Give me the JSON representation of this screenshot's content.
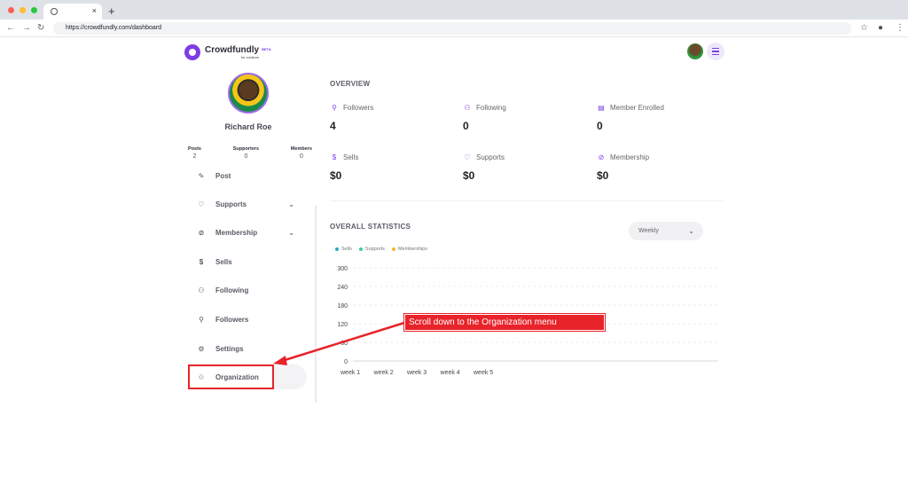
{
  "browser": {
    "url": "https://crowdfundly.com/dashboard",
    "tab_close": "×",
    "new_tab": "+"
  },
  "brand": {
    "name": "Crowdfundly",
    "sub": "for creators",
    "badge": "BETA",
    "accent": "#7b3fe4"
  },
  "profile": {
    "name": "Richard Roe",
    "stats": [
      {
        "label": "Posts",
        "value": "2"
      },
      {
        "label": "Supporters",
        "value": "0"
      },
      {
        "label": "Members",
        "value": "0"
      }
    ]
  },
  "sidebar": {
    "items": [
      {
        "label": "Post",
        "icon": "edit-icon"
      },
      {
        "label": "Supports",
        "icon": "heart-icon"
      },
      {
        "label": "Membership",
        "icon": "membership-icon"
      },
      {
        "label": "Sells",
        "icon": "dollar-icon"
      },
      {
        "label": "Following",
        "icon": "users-icon"
      },
      {
        "label": "Followers",
        "icon": "user-check-icon"
      },
      {
        "label": "Settings",
        "icon": "gear-icon"
      },
      {
        "label": "Organization",
        "icon": "organization-icon"
      }
    ]
  },
  "overview": {
    "title": "OVERVIEW",
    "metrics": [
      {
        "label": "Followers",
        "value": "4",
        "icon": "user-check-icon"
      },
      {
        "label": "Following",
        "value": "0",
        "icon": "users-icon"
      },
      {
        "label": "Member Enrolled",
        "value": "0",
        "icon": "id-card-icon"
      },
      {
        "label": "Sells",
        "value": "$0",
        "icon": "dollar-icon"
      },
      {
        "label": "Supports",
        "value": "$0",
        "icon": "heart-icon"
      },
      {
        "label": "Membership",
        "value": "$0",
        "icon": "membership-icon"
      }
    ]
  },
  "statistics": {
    "title": "OVERALL STATISTICS",
    "period": "Weekly"
  },
  "chart_data": {
    "type": "line",
    "categories": [
      "week 1",
      "week 2",
      "week 3",
      "week 4",
      "week 5"
    ],
    "series": [
      {
        "name": "Sells",
        "values": [
          0,
          0,
          0,
          0,
          0
        ],
        "color": "#2aa7c9"
      },
      {
        "name": "Supports",
        "values": [
          0,
          0,
          0,
          0,
          0
        ],
        "color": "#3ecf9c"
      },
      {
        "name": "Memberships",
        "values": [
          0,
          0,
          0,
          0,
          0
        ],
        "color": "#f5b72a"
      }
    ],
    "yticks": [
      "300",
      "240",
      "180",
      "120",
      "60",
      "0"
    ],
    "ylim": [
      0,
      300
    ],
    "grid": true,
    "legend": "top-left"
  },
  "annotation": {
    "text": "Scroll down to the Organization menu",
    "color": "#e8232a"
  }
}
